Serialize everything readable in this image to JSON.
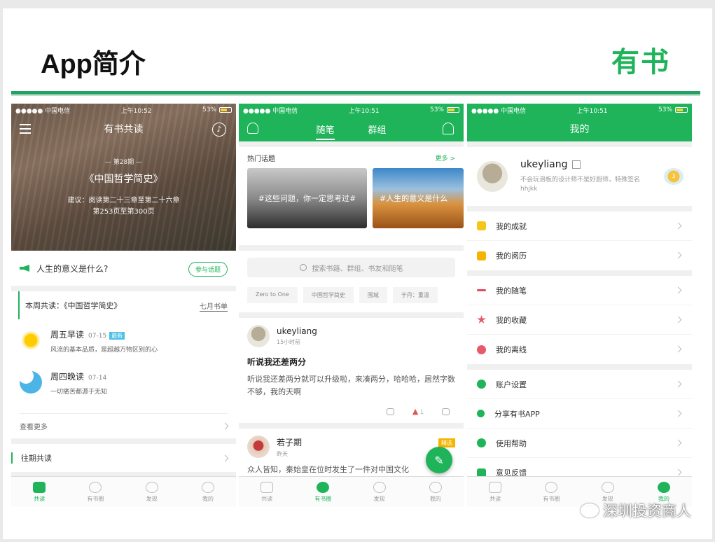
{
  "slide": {
    "title": "App简介",
    "logo": "有书"
  },
  "status": {
    "carrier": "●●●●● 中国电信",
    "battery": "53%",
    "time1": "上午10:52",
    "time2": "上午10:51",
    "time3": "上午10:51"
  },
  "phone1": {
    "nav_title": "有书共读",
    "issue": "— 第28期 —",
    "book": "《中国哲学简史》",
    "suggest_line1": "建议：阅读第二十三章至第二十六章",
    "suggest_line2": "第253页至第300页",
    "topic": "人生的意义是什么?",
    "join_label": "参与话题",
    "week_title": "本周共读：《中国哲学简史》",
    "week_month": "七月书单",
    "items": [
      {
        "title": "周五早读",
        "date": "07-15",
        "badge": "最新",
        "desc": "风流的基本品质，是超越万物区别的心"
      },
      {
        "title": "周四晚读",
        "date": "07-14",
        "badge": "",
        "desc": "一切痛苦都源于无知"
      }
    ],
    "see_more": "查看更多",
    "past": "往期共读"
  },
  "tabs": [
    "共读",
    "有书圈",
    "发现",
    "我的"
  ],
  "phone2": {
    "tab_active": "随笔",
    "tab_other": "群组",
    "hot_title": "热门话题",
    "hot_more": "更多 >",
    "hot_a": "#这些问题，你一定思考过#",
    "hot_b": "#人生的意义是什么",
    "search_placeholder": "搜索书籍、群组、书友和随笔",
    "chips": [
      "Zero to One",
      "中国哲学简史",
      "围城",
      "于丹：重温"
    ],
    "post1": {
      "name": "ukeyliang",
      "time": "15小时前",
      "title": "听说我还差两分",
      "body": "听说我还差两分就可以升级啦，来凑两分，哈哈哈，居然字数不够，我的天啊",
      "likes": "1"
    },
    "post2": {
      "name": "若子期",
      "time": "昨天",
      "badge": "精选",
      "body": "众人皆知，秦始皇在位时发生了一件对中国文化"
    }
  },
  "phone3": {
    "title": "我的",
    "name": "ukeyliang",
    "bio": "不会玩滑板的设计师不是好厨师，特殊签名hhjkk",
    "level": "3",
    "group1": [
      "我的成就",
      "我的阅历"
    ],
    "group2": [
      "我的随笔",
      "我的收藏",
      "我的离线"
    ],
    "group3": [
      "账户设置",
      "分享有书APP",
      "使用帮助",
      "意见反馈"
    ]
  },
  "watermark": "深圳投资商人",
  "colors": {
    "brand": "#1fb45a",
    "rule": "#23a163"
  }
}
